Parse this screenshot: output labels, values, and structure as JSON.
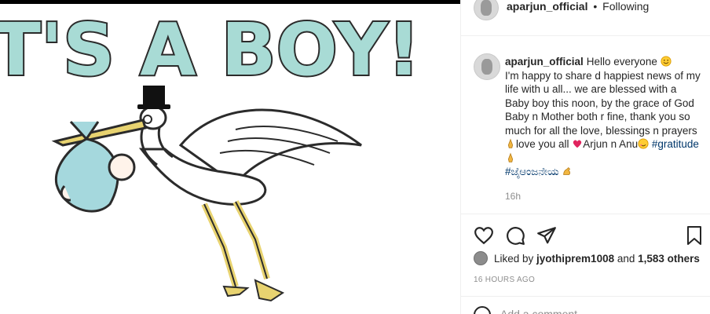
{
  "post": {
    "image": {
      "headline": "IT'S A BOY!",
      "illustration": "stork-delivering-baby"
    }
  },
  "header": {
    "username": "aparjun_official",
    "separator": "•",
    "follow_state": "Following"
  },
  "caption": {
    "username": "aparjun_official",
    "line1": "Hello everyone ",
    "line1_emoji": "smiling-face",
    "line2": "I'm happy to share d happiest news of my life with u all... we are blessed with a Baby boy this noon, by the grace of God Baby n Mother both r fine, thank you so much for all the love, blessings n prayers ",
    "pray_emoji_1": "folded-hands",
    "line3": "love you all ",
    "heart_emoji": "red-heart",
    "line4": "Arjun n Anu",
    "blush_emoji": "smiling-face-with-hearts",
    "hashtag1": "#gratitude",
    "pray_emoji_2": "folded-hands",
    "hashtag2": "#ಜೈಆಂಜನೇಯ",
    "muscle_emoji": "flexed-biceps",
    "relative_time": "16h"
  },
  "actions": {
    "like_icon": "heart-icon",
    "comment_icon": "comment-icon",
    "share_icon": "share-icon",
    "save_icon": "bookmark-icon"
  },
  "likes": {
    "prefix": "Liked by ",
    "user": "jyothiprem1008",
    "middle": " and ",
    "count": "1,583 others"
  },
  "post_date": "16 HOURS AGO",
  "comment_box": {
    "placeholder": "Add a comment..."
  },
  "colors": {
    "text": "#262626",
    "muted": "#8e8e8e",
    "hashtag": "#00376b",
    "headline_fill": "#a8dbd5",
    "baby_blanket": "#a5d8dd",
    "stork_legs": "#e8d370"
  }
}
